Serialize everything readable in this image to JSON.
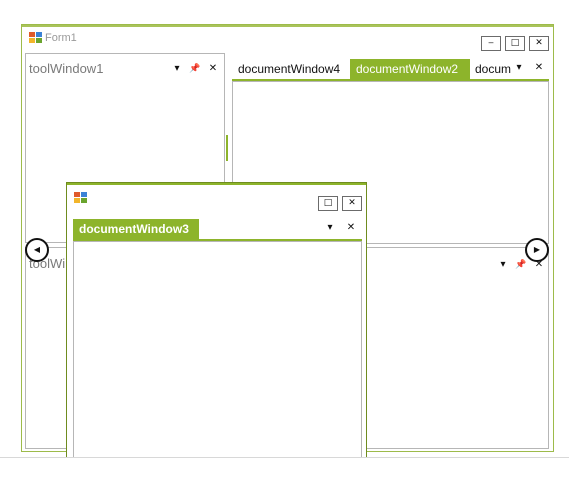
{
  "form": {
    "title": "Form1",
    "minimize_glyph": "‒",
    "maximize_glyph": "□",
    "close_glyph": "✕"
  },
  "tool_window_1": {
    "title": "toolWindow1",
    "dropdown_glyph": "▾",
    "pin_glyph": "📌",
    "close_glyph": "✕"
  },
  "tool_window_2": {
    "title": "toolWi",
    "dropdown_glyph": "▾",
    "pin_glyph": "📌",
    "close_glyph": "✕"
  },
  "document_tabs": [
    {
      "label": "documentWindow4",
      "active": false
    },
    {
      "label": "documentWindow2",
      "active": true
    },
    {
      "label": "docum",
      "active": false
    }
  ],
  "document_tabstrip": {
    "dropdown_glyph": "▾",
    "close_glyph": "✕"
  },
  "floating_window": {
    "tab_label": "documentWindow3",
    "maximize_glyph": "□",
    "close_glyph": "✕",
    "dropdown_glyph": "▾",
    "tab_close_glyph": "✕"
  },
  "dock_guides": {
    "left_glyph": "◀",
    "right_glyph": "▶"
  },
  "colors": {
    "accent": "#8db42b",
    "border": "#9dbb4a"
  }
}
